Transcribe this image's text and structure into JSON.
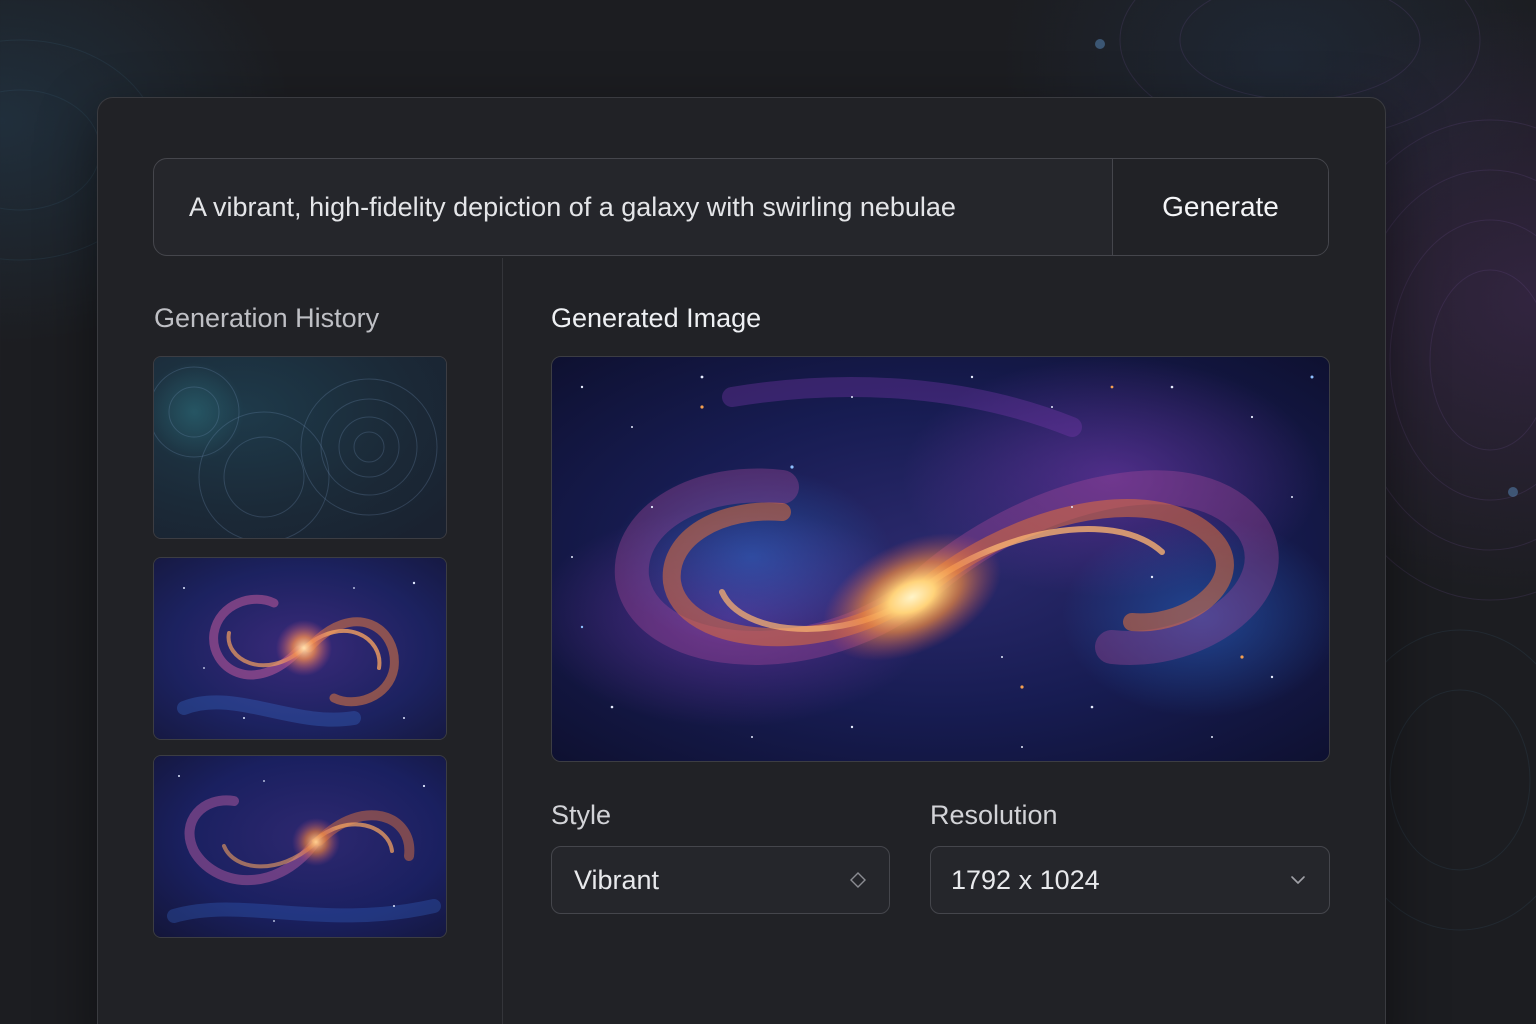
{
  "prompt": {
    "value": "A vibrant, high-fidelity depiction of a galaxy with swirling nebulae",
    "generate_label": "Generate"
  },
  "history": {
    "title": "Generation History",
    "items": [
      {
        "icon": "abstract-swirl-thumbnail"
      },
      {
        "icon": "galaxy-thumbnail"
      },
      {
        "icon": "galaxy-thumbnail"
      }
    ]
  },
  "preview": {
    "title": "Generated Image"
  },
  "controls": {
    "style": {
      "label": "Style",
      "value": "Vibrant",
      "icon": "diamond-icon"
    },
    "resolution": {
      "label": "Resolution",
      "value": "1792 x 1024",
      "icon": "chevron-down-icon"
    }
  },
  "colors": {
    "background": "#1c1d21",
    "panel": "#212226",
    "border": "#3a3b40",
    "galaxy_core": "#ffd37a",
    "galaxy_arm": "#e0703a",
    "nebula_purple": "#7a3ab0",
    "nebula_blue": "#2a4fa8"
  }
}
